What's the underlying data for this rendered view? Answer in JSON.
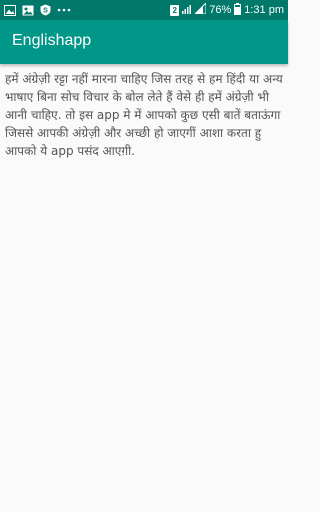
{
  "status_bar": {
    "notification_icons": [
      "image-icon",
      "photo-icon",
      "shield-icon",
      "more-dots-icon"
    ],
    "sim_label": "2",
    "battery_percent": "76%",
    "time": "1:31 pm"
  },
  "app_bar": {
    "title": "Englishapp"
  },
  "main": {
    "body_text": "हमें अंग्रेज़ी रट्टा नहीं मारना चाहिए जिस तरह से हम हिंदी या अन्य भाषाए बिना सोच विचार के बोल लेते हैं वेसे ही हमें अंग्रेज़ी भी आनी चाहिए. तो इस app मे में आपको कुछ एसी बातें बताऊंगा जिससे आपकी अंग्रेज़ी और अच्छी हो जाएगीं आशा करता हु आपको ये app पसंद आएग़ी."
  },
  "colors": {
    "status_bar": "#00796b",
    "app_bar": "#009688",
    "background": "#fafafa",
    "body_text": "#555555"
  }
}
